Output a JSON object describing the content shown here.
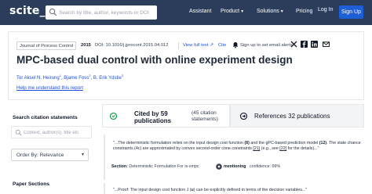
{
  "header": {
    "logo": "scite",
    "logo_suffix": "_",
    "search_placeholder": "Search by title, author, keywords or DOI",
    "nav": [
      {
        "label": "Assistant",
        "has_chevron": false
      },
      {
        "label": "Product",
        "has_chevron": true
      },
      {
        "label": "Solutions",
        "has_chevron": true
      },
      {
        "label": "Pricing",
        "has_chevron": false
      }
    ],
    "login_label": "Log In",
    "signup_label": "Sign Up"
  },
  "article": {
    "journal": "Journal of Process Control",
    "year": "2015",
    "doi": "DOI: 10.1016/j.jprocont.2015.04.012",
    "fulltext_label": "View full text",
    "cite_label": "Cite",
    "alerts_label": "Sign up to set email alerts",
    "title": "MPC-based dual control with online experiment design",
    "authors": [
      {
        "name": "Tor Aksel N. Heirung",
        "sup": "1"
      },
      {
        "name": "Bjarne Foss",
        "sup": "2"
      },
      {
        "name": "B. Erik Ydstie",
        "sup": "3"
      }
    ],
    "help_label": "Help me understand this report"
  },
  "sidebar": {
    "heading": "Search citation statements",
    "search_placeholder": "Context, author(s), title etc",
    "order_label": "Order By: Relevance",
    "paper_sections_label": "Paper Sections"
  },
  "tabs": {
    "cited_count": "Cited by 59 publications",
    "cited_sub": "(45 citation statements)",
    "references": "References 32 publications"
  },
  "citations": [
    {
      "quote_pre": "\"...The deterministic formulation relies on the input design cost function ",
      "quote_ref1": "(8)",
      "quote_mid": " and the gPC-based prediction model ",
      "quote_ref2": "(12)",
      "quote_post": ". The state chance constraints (4c) are approximated by convex second-order cone constraints ",
      "quote_ref3": "[21]",
      "quote_and": " (e.g., see ",
      "quote_ref4": "[22]",
      "quote_end": " for the details)...\"",
      "section_label": "Section:",
      "section_value": "Deterministic Formulation For is-smpc",
      "mention_label": "mentioning",
      "mention_count": "confidence: 99%"
    },
    {
      "quote_pre": "\"...Proof: The input design cost function J (",
      "quote_sym": "u",
      "quote_post": ") can be explicitly defined in terms of the decision variables",
      "quote_end": "...\""
    }
  ],
  "colors": {
    "header_bg": "#2b3d5a",
    "signup_bg": "#1d5fd6",
    "link": "#1d4ed8",
    "mention_badge": "#374151"
  }
}
